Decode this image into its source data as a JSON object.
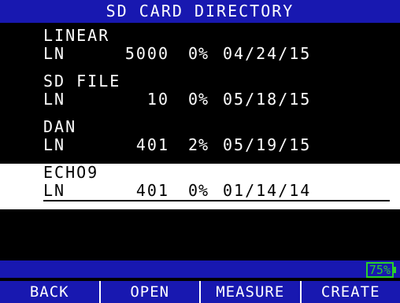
{
  "header": {
    "title": "SD CARD DIRECTORY"
  },
  "files": [
    {
      "name": "LINEAR",
      "type": "LN",
      "count": "5000",
      "percent": "0%",
      "date": "04/24/15"
    },
    {
      "name": "SD FILE",
      "type": "LN",
      "count": "10",
      "percent": "0%",
      "date": "05/18/15"
    },
    {
      "name": "DAN",
      "type": "LN",
      "count": "401",
      "percent": "2%",
      "date": "05/19/15"
    },
    {
      "name": "ECHO9",
      "type": "LN",
      "count": "401",
      "percent": "0%",
      "date": "01/14/14",
      "selected": true
    }
  ],
  "status": {
    "battery": "75%"
  },
  "softkeys": {
    "back": "BACK",
    "open": "OPEN",
    "measure": "MEASURE",
    "create": "CREATE"
  },
  "colors": {
    "bar_blue": "#1818b0",
    "battery_green": "#2ad02a",
    "selection": "#ffffff"
  },
  "icons": {
    "selected_marker": "open-folder-icon"
  }
}
